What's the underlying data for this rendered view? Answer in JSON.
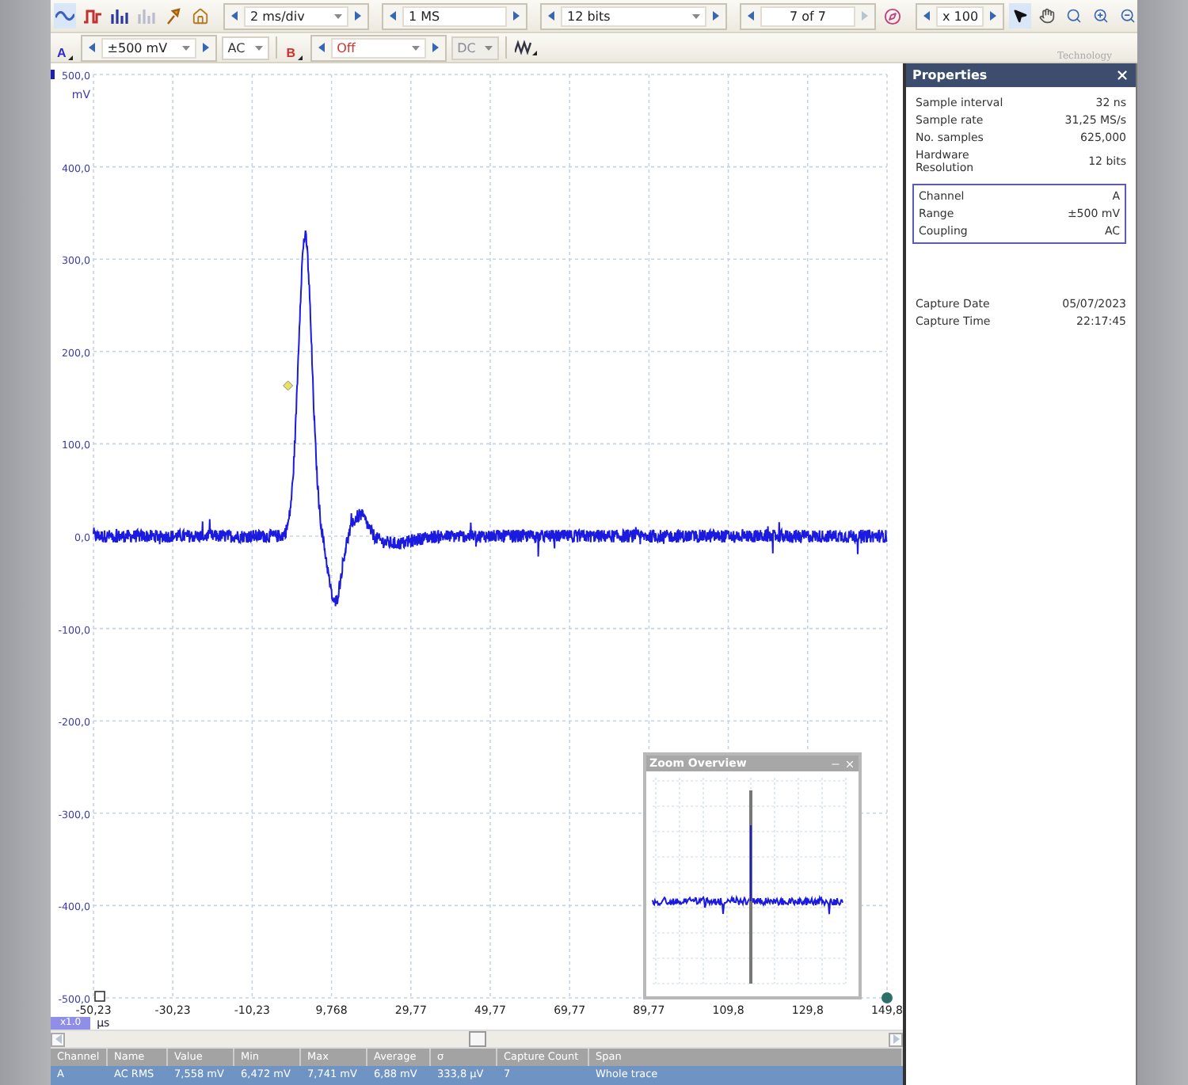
{
  "toolbar": {
    "timebase": "2 ms/div",
    "samples": "1 MS",
    "resolution": "12 bits",
    "buffer": "7 of 7",
    "zoom": "x 100",
    "logo_text": "Technology"
  },
  "channels": [
    {
      "label": "A",
      "color": "#2a2ad0",
      "range": "±500 mV",
      "coupling": "AC",
      "enabled": true
    },
    {
      "label": "B",
      "color": "#d03030",
      "range": "Off",
      "coupling": "DC",
      "enabled": false
    }
  ],
  "chart": {
    "unit": "mV",
    "y_ticks": [
      "500,0",
      "400,0",
      "300,0",
      "200,0",
      "100,0",
      "0,0",
      "-100,0",
      "-200,0",
      "-300,0",
      "-400,0",
      "-500,0"
    ],
    "x_ticks": [
      "-50,23",
      "-30,23",
      "-10,23",
      "9,768",
      "29,77",
      "49,77",
      "69,77",
      "89,77",
      "109,8",
      "129,8",
      "149,8"
    ],
    "x_scale": "x1.0",
    "x_unit": "µs"
  },
  "zoom_overview": {
    "title": "Zoom Overview"
  },
  "properties": {
    "title": "Properties",
    "rows": [
      {
        "label": "Sample interval",
        "value": "32 ns"
      },
      {
        "label": "Sample rate",
        "value": "31,25 MS/s"
      },
      {
        "label": "No. samples",
        "value": "625,000"
      },
      {
        "label": "Hardware Resolution",
        "value": "12 bits"
      }
    ],
    "channel_rows": [
      {
        "label": "Channel",
        "value": "A"
      },
      {
        "label": "Range",
        "value": "±500 mV"
      },
      {
        "label": "Coupling",
        "value": "AC"
      }
    ],
    "capture_rows": [
      {
        "label": "Capture Date",
        "value": "05/07/2023"
      },
      {
        "label": "Capture Time",
        "value": "22:17:45"
      }
    ]
  },
  "measurements": {
    "columns": [
      "Channel",
      "Name",
      "Value",
      "Min",
      "Max",
      "Average",
      "σ",
      "Capture Count",
      "Span"
    ],
    "rows": [
      {
        "selected": true,
        "cells": [
          "A",
          "AC RMS",
          "7,558 mV",
          "6,472 mV",
          "7,741 mV",
          "6,88 mV",
          "333,8 µV",
          "7",
          "Whole trace"
        ]
      }
    ]
  }
}
